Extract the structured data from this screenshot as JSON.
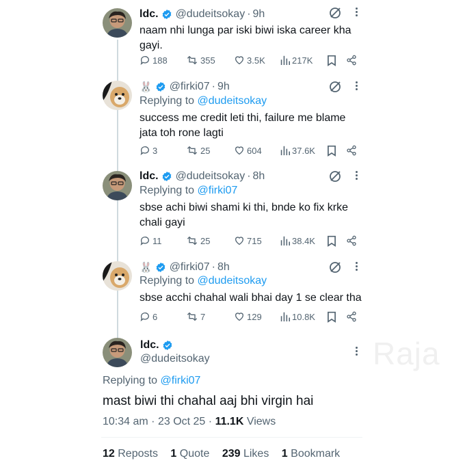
{
  "watermark": "Raja",
  "tweets": [
    {
      "name": "ldc.",
      "emoji": "",
      "handle": "@dudeitsokay",
      "time": "9h",
      "replying_prefix": "",
      "replying_to": "",
      "text": "naam nhi lunga par iski biwi iska career kha gayi.",
      "replies": "188",
      "reposts": "355",
      "likes": "3.5K",
      "views": "217K"
    },
    {
      "name": "",
      "emoji": "🐰",
      "handle": "@firki07",
      "time": "9h",
      "replying_prefix": "Replying to",
      "replying_to": "@dudeitsokay",
      "text": "success me credit leti thi, failure me blame jata toh rone lagti",
      "replies": "3",
      "reposts": "25",
      "likes": "604",
      "views": "37.6K"
    },
    {
      "name": "ldc.",
      "emoji": "",
      "handle": "@dudeitsokay",
      "time": "8h",
      "replying_prefix": "Replying to",
      "replying_to": "@firki07",
      "text": "sbse achi biwi shami ki thi, bnde ko fix krke chali gayi",
      "replies": "11",
      "reposts": "25",
      "likes": "715",
      "views": "38.4K"
    },
    {
      "name": "",
      "emoji": "🐰",
      "handle": "@firki07",
      "time": "8h",
      "replying_prefix": "Replying to",
      "replying_to": "@dudeitsokay",
      "text": "sbse acchi chahal wali bhai day 1 se clear tha",
      "replies": "6",
      "reposts": "7",
      "likes": "129",
      "views": "10.8K"
    }
  ],
  "main_tweet": {
    "name": "ldc.",
    "handle": "@dudeitsokay",
    "replying_prefix": "Replying to",
    "replying_to": "@firki07",
    "text": "mast biwi thi chahal aaj bhi virgin hai",
    "time": "10:34 am",
    "date": "23 Oct 25",
    "views_count": "11.1K",
    "views_label": "Views",
    "reposts_count": "12",
    "reposts_label": "Reposts",
    "quotes_count": "1",
    "quotes_label": "Quote",
    "likes_count": "239",
    "likes_label": "Likes",
    "bookmarks_count": "1",
    "bookmarks_label": "Bookmark"
  },
  "colors": {
    "accent": "#1d9bf0",
    "secondary_text": "#536471",
    "primary_text": "#0f1419",
    "thread_line": "#cfd9de"
  },
  "icons": [
    "verified-badge-icon",
    "grok-icon",
    "more-icon",
    "reply-icon",
    "repost-icon",
    "like-icon",
    "views-icon",
    "bookmark-icon",
    "share-icon"
  ]
}
